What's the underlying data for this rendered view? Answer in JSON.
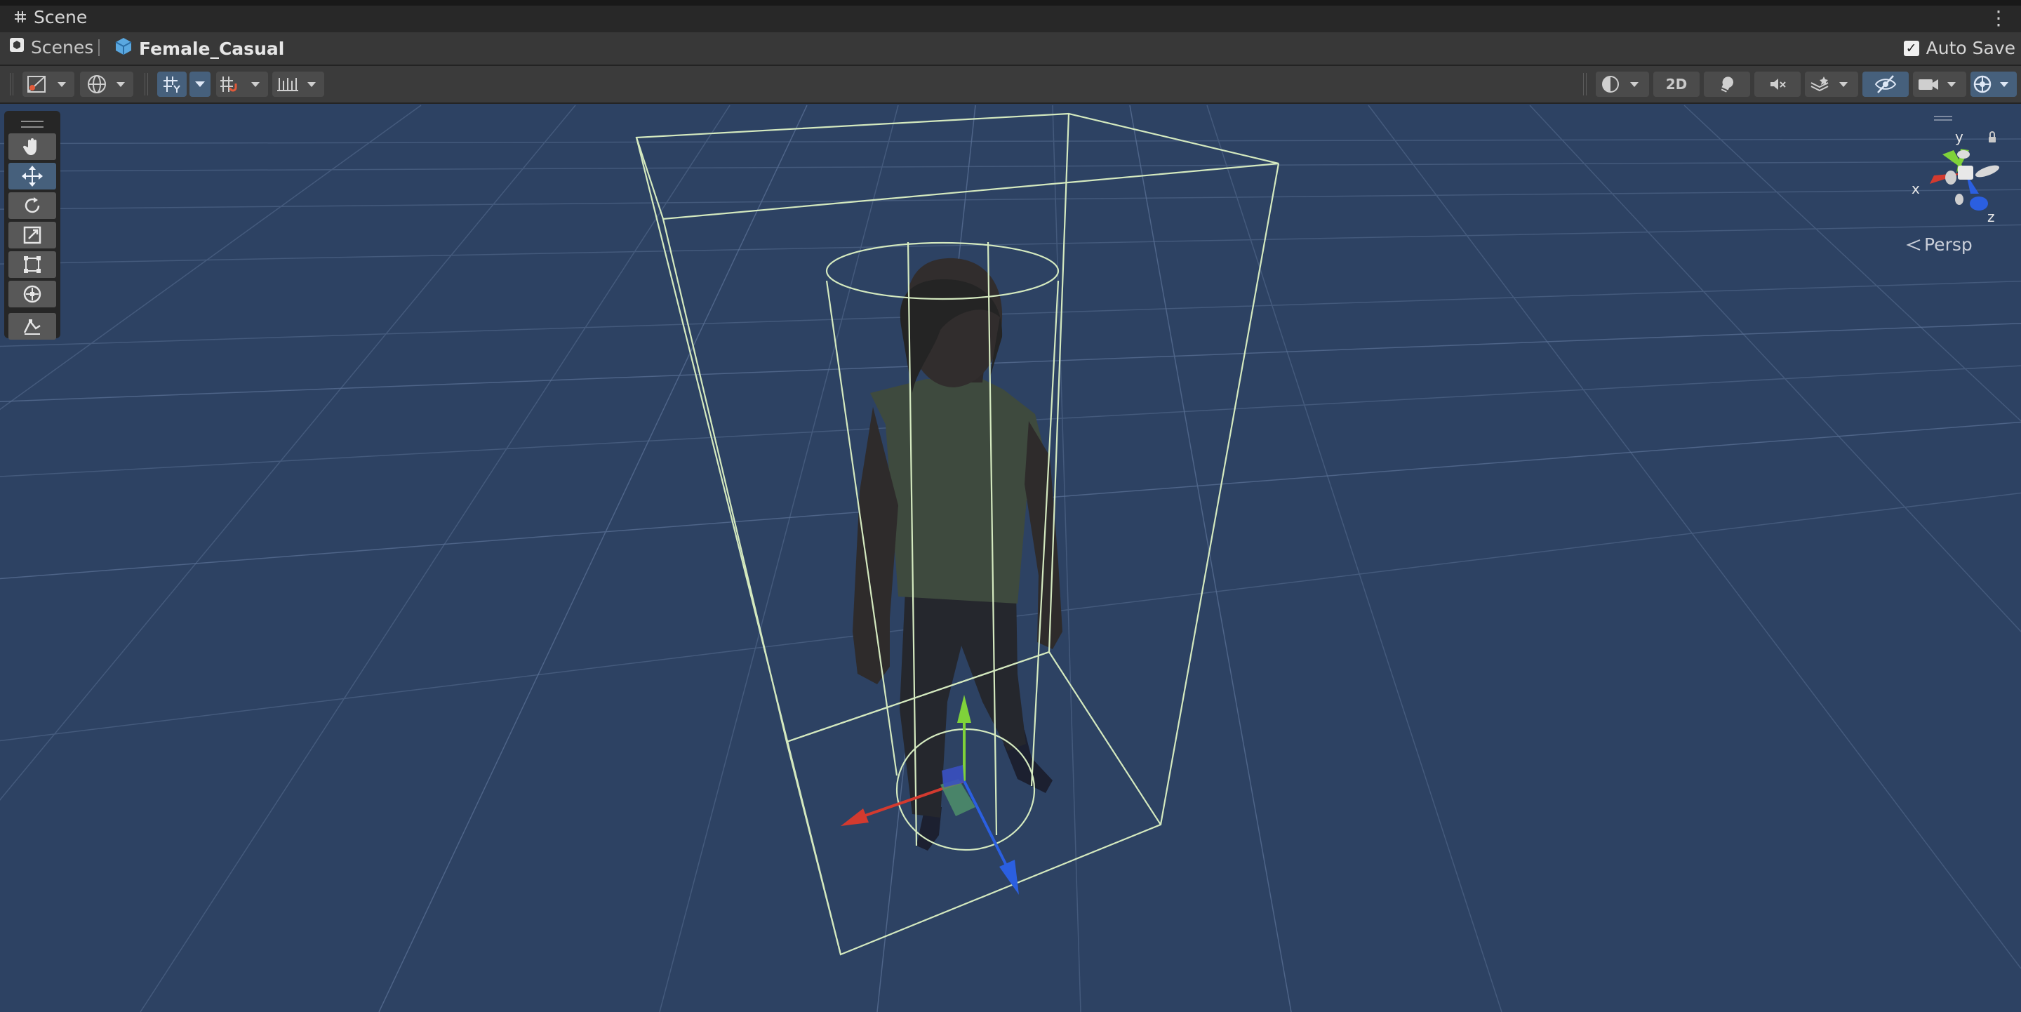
{
  "window": {
    "tab_title": "Scene"
  },
  "breadcrumb": {
    "root": "Scenes",
    "current": "Female_Casual"
  },
  "autosave": {
    "label": "Auto Save",
    "checked": true
  },
  "toolbar": {
    "mode_2d": "2D"
  },
  "gizmo": {
    "x": "x",
    "y": "y",
    "z": "z",
    "projection": "Persp"
  },
  "tools": [
    "hand-tool",
    "move-tool",
    "rotate-tool",
    "scale-tool",
    "rect-tool",
    "transform-tool",
    "custom-tool"
  ],
  "colors": {
    "viewport": "#2d4263",
    "selection": "#cfe8b8",
    "x_axis": "#d33a2f",
    "y_axis": "#7fd23a",
    "z_axis": "#2b5fe0",
    "active_tool": "#46607c"
  }
}
